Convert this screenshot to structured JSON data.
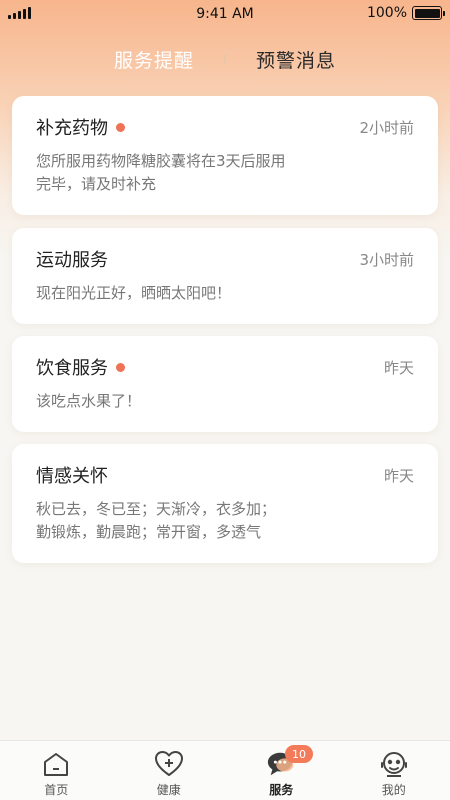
{
  "status_bar": {
    "time": "9:41 AM",
    "battery": "100%"
  },
  "tabs": [
    {
      "label": "服务提醒",
      "active": false
    },
    {
      "label": "预警消息",
      "active": true
    }
  ],
  "cards": [
    {
      "title": "补充药物",
      "unread": true,
      "time": "2小时前",
      "lines": [
        "您所服用药物降糖胶囊将在3天后服用",
        "完毕，请及时补充"
      ]
    },
    {
      "title": "运动服务",
      "unread": false,
      "time": "3小时前",
      "lines": [
        "现在阳光正好，晒晒太阳吧！"
      ]
    },
    {
      "title": "饮食服务",
      "unread": true,
      "time": "昨天",
      "lines": [
        "该吃点水果了！"
      ]
    },
    {
      "title": "情感关怀",
      "unread": false,
      "time": "昨天",
      "lines": [
        "秋已去，冬已至；天渐冷，衣多加；",
        "勤锻炼，勤晨跑；常开窗，多透气"
      ]
    }
  ],
  "tabbar": {
    "items": [
      {
        "label": "首页",
        "icon": "home-icon"
      },
      {
        "label": "健康",
        "icon": "heart-plus-icon"
      },
      {
        "label": "服务",
        "icon": "chat-icon",
        "badge": "10",
        "active": true
      },
      {
        "label": "我的",
        "icon": "profile-icon"
      }
    ]
  },
  "colors": {
    "accent": "#ee7254",
    "badge": "#f47b5a",
    "header_top": "#f7b58c"
  }
}
